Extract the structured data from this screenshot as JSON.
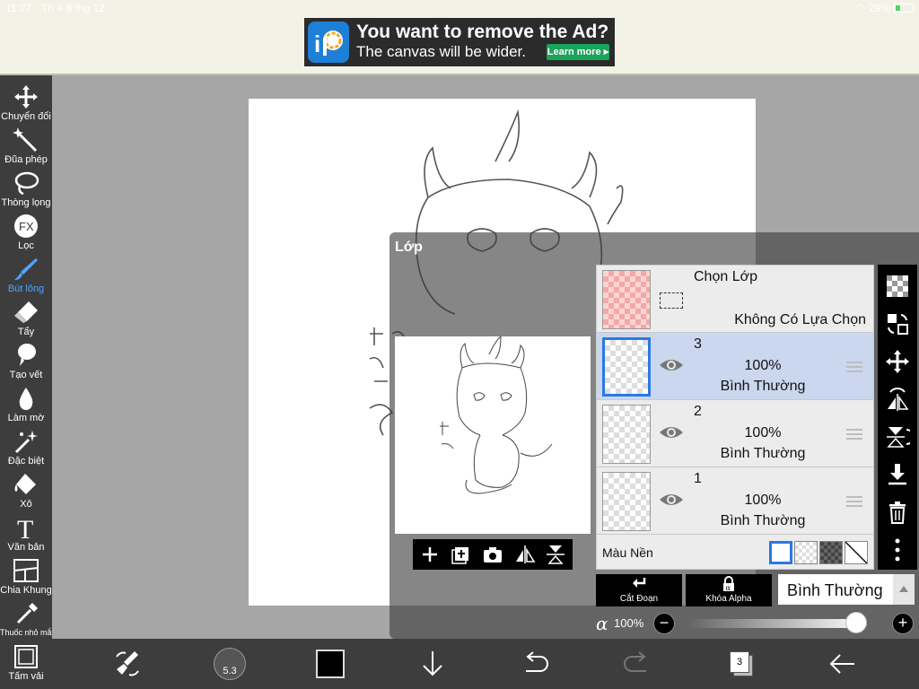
{
  "status": {
    "time": "11:27",
    "date": "Th 4 8 thg 12",
    "battery": "29%"
  },
  "ad": {
    "line1": "You want to remove the Ad?",
    "line2": "The canvas will be wider.",
    "learn_more": "Learn more ▸"
  },
  "toolbar": {
    "items": [
      {
        "label": "Chuyển đổi",
        "icon": "move-icon"
      },
      {
        "label": "Đũa phép",
        "icon": "magic-wand-icon"
      },
      {
        "label": "Thòng lọng",
        "icon": "lasso-icon"
      },
      {
        "label": "Lọc",
        "icon": "fx-icon",
        "glyph": "FX"
      },
      {
        "label": "Bút lông",
        "icon": "brush-icon",
        "active": true
      },
      {
        "label": "Tẩy",
        "icon": "eraser-icon"
      },
      {
        "label": "Tạo vết",
        "icon": "smudge-icon"
      },
      {
        "label": "Làm mờ",
        "icon": "blur-icon"
      },
      {
        "label": "Đặc biệt",
        "icon": "special-icon"
      },
      {
        "label": "Xô",
        "icon": "bucket-icon"
      },
      {
        "label": "Văn bản",
        "icon": "text-icon",
        "glyph": "T"
      },
      {
        "label": "Chia Khung",
        "icon": "frame-divider-icon"
      },
      {
        "label": "Thuốc nhỏ mắt",
        "icon": "eyedropper-icon"
      },
      {
        "label": "Tấm vải",
        "icon": "canvas-icon"
      }
    ]
  },
  "layer_panel": {
    "title": "Lớp",
    "selection_row": {
      "title": "Chọn Lớp",
      "subtitle": "Không Có Lựa Chọn"
    },
    "layers": [
      {
        "name": "3",
        "opacity": "100%",
        "mode": "Bình Thường",
        "selected": true
      },
      {
        "name": "2",
        "opacity": "100%",
        "mode": "Bình Thường",
        "selected": false
      },
      {
        "name": "1",
        "opacity": "100%",
        "mode": "Bình Thường",
        "selected": false
      }
    ],
    "background_label": "Màu Nền",
    "clipping_label": "Cắt Đoạn",
    "alpha_lock_label": "Khóa Alpha",
    "blend_mode": "Bình Thường",
    "alpha_symbol": "α",
    "alpha_value": "100%",
    "alpha_fraction": 1.0
  },
  "bottombar": {
    "brush_size": "5.3",
    "color": "#000000",
    "layer_count": "3"
  },
  "colors": {
    "accent": "#2b78e4",
    "active_tool": "#4fa6ff",
    "toolbar_bg": "#3d3d3d"
  }
}
